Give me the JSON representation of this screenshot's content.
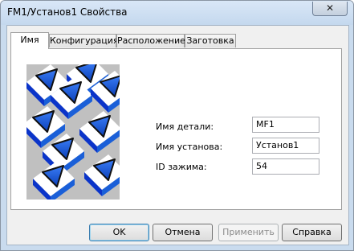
{
  "window": {
    "title": "FM1/Установ1 Свойства",
    "close_glyph": "✕"
  },
  "tabs": [
    {
      "label": "Имя"
    },
    {
      "label": "Конфигурация"
    },
    {
      "label": "Расположение"
    },
    {
      "label": "Заготовка"
    }
  ],
  "form": {
    "part_name_label": "Имя детали:",
    "part_name_value": "MF1",
    "setup_name_label": "Имя установа:",
    "setup_name_value": "Установ1",
    "clamp_id_label": "ID зажима:",
    "clamp_id_value": "54"
  },
  "buttons": {
    "ok": "OK",
    "cancel": "Отмена",
    "apply": "Применить",
    "help": "Справка"
  },
  "colors": {
    "accent": "#1a5fd8",
    "titlebar": "#c9dbee"
  }
}
